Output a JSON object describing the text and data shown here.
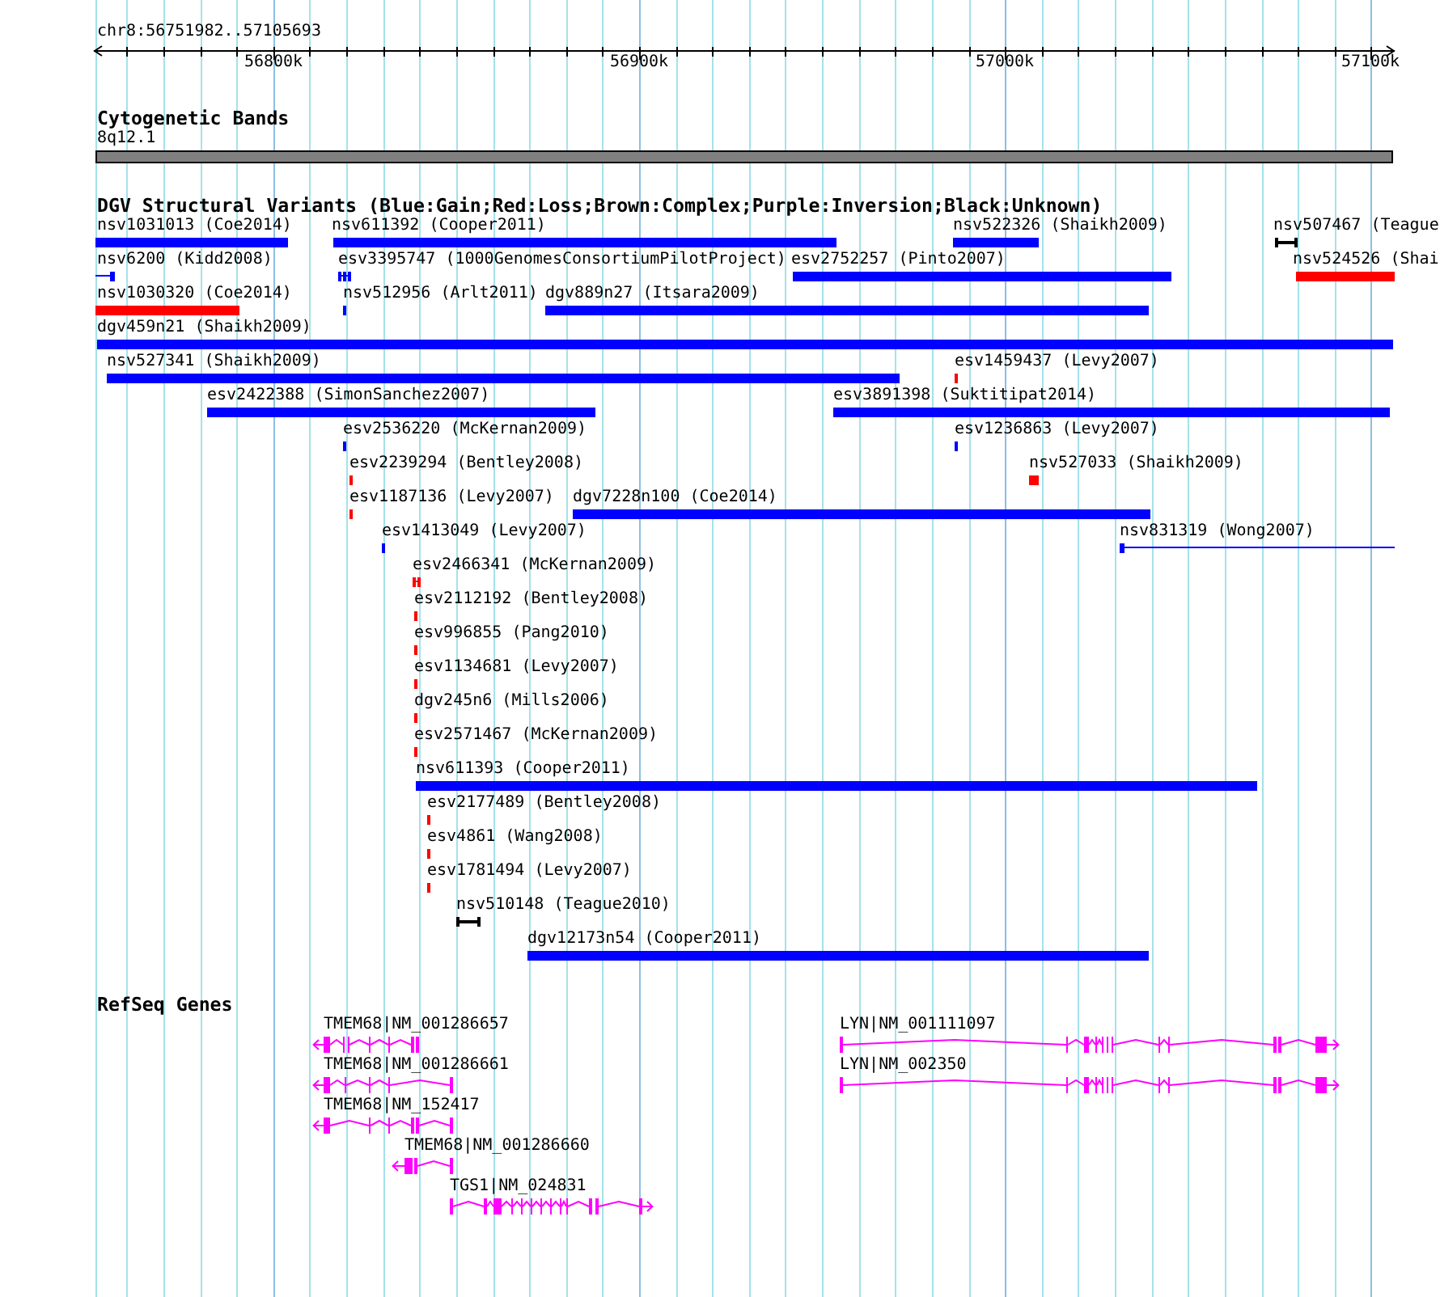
{
  "ruler": {
    "location": "chr8:56751982..57105693",
    "ticks": [
      "56800k",
      "56900k",
      "57000k",
      "57100k"
    ]
  },
  "cytogenetic_bands": {
    "title": "Cytogenetic Bands",
    "bands": [
      {
        "label": "8q12.1"
      }
    ]
  },
  "dgv_structural_variants": {
    "title": "DGV Structural Variants (Blue:Gain;Red:Loss;Brown:Complex;Purple:Inversion;Black:Unknown)",
    "rows": [
      {
        "variants": [
          {
            "label": "nsv1031013 (Coe2014)",
            "kind": "bar",
            "color": "#0000ff"
          },
          {
            "label": "nsv611392 (Cooper2011)",
            "kind": "bar",
            "color": "#0000ff"
          },
          {
            "label": "nsv522326 (Shaikh2009)",
            "kind": "bar",
            "color": "#0000ff"
          },
          {
            "label": "nsv507467 (Teague",
            "kind": "interval",
            "color": "#000000"
          }
        ]
      },
      {
        "variants": [
          {
            "label": "nsv6200 (Kidd2008)",
            "kind": "line",
            "color": "#0000ff"
          },
          {
            "label": "esv3395747 (1000GenomesConsortiumPilotProject)",
            "kind": "segments",
            "color": "#0000ff"
          },
          {
            "label": "esv2752257 (Pinto2007)",
            "kind": "bar",
            "color": "#0000ff"
          },
          {
            "label": "nsv524526 (Shai",
            "kind": "bar",
            "color": "#ff0000"
          }
        ]
      },
      {
        "variants": [
          {
            "label": "nsv1030320 (Coe2014)",
            "kind": "bar",
            "color": "#ff0000"
          },
          {
            "label": "nsv512956 (Arlt2011)",
            "kind": "bar",
            "color": "#0000ff"
          },
          {
            "label": "dgv889n27 (Itsara2009)",
            "kind": "bar",
            "color": "#0000ff"
          }
        ]
      },
      {
        "variants": [
          {
            "label": "dgv459n21 (Shaikh2009)",
            "kind": "bar",
            "color": "#0000ff"
          }
        ]
      },
      {
        "variants": [
          {
            "label": "nsv527341 (Shaikh2009)",
            "kind": "bar",
            "color": "#0000ff"
          },
          {
            "label": "esv1459437 (Levy2007)",
            "kind": "bar",
            "color": "#ff0000"
          }
        ]
      },
      {
        "variants": [
          {
            "label": "esv2422388 (SimonSanchez2007)",
            "kind": "bar",
            "color": "#0000ff"
          },
          {
            "label": "esv3891398 (Suktitipat2014)",
            "kind": "bar",
            "color": "#0000ff"
          }
        ]
      },
      {
        "variants": [
          {
            "label": "esv2536220 (McKernan2009)",
            "kind": "bar",
            "color": "#0000ff"
          },
          {
            "label": "esv1236863 (Levy2007)",
            "kind": "bar",
            "color": "#0000ff"
          }
        ]
      },
      {
        "variants": [
          {
            "label": "esv2239294 (Bentley2008)",
            "kind": "bar",
            "color": "#ff0000"
          },
          {
            "label": "nsv527033 (Shaikh2009)",
            "kind": "bar",
            "color": "#ff0000"
          }
        ]
      },
      {
        "variants": [
          {
            "label": "esv1187136 (Levy2007)",
            "kind": "bar",
            "color": "#ff0000"
          },
          {
            "label": "dgv7228n100 (Coe2014)",
            "kind": "bar",
            "color": "#0000ff"
          }
        ]
      },
      {
        "variants": [
          {
            "label": "esv1413049 (Levy2007)",
            "kind": "bar",
            "color": "#0000ff"
          },
          {
            "label": "nsv831319 (Wong2007)",
            "kind": "line",
            "color": "#0000ff"
          }
        ]
      },
      {
        "variants": [
          {
            "label": "esv2466341 (McKernan2009)",
            "kind": "segments",
            "color": "#ff0000"
          }
        ]
      },
      {
        "variants": [
          {
            "label": "esv2112192 (Bentley2008)",
            "kind": "bar",
            "color": "#ff0000"
          }
        ]
      },
      {
        "variants": [
          {
            "label": "esv996855 (Pang2010)",
            "kind": "bar",
            "color": "#ff0000"
          }
        ]
      },
      {
        "variants": [
          {
            "label": "esv1134681 (Levy2007)",
            "kind": "bar",
            "color": "#ff0000"
          }
        ]
      },
      {
        "variants": [
          {
            "label": "dgv245n6 (Mills2006)",
            "kind": "bar",
            "color": "#ff0000"
          }
        ]
      },
      {
        "variants": [
          {
            "label": "esv2571467 (McKernan2009)",
            "kind": "bar",
            "color": "#ff0000"
          }
        ]
      },
      {
        "variants": [
          {
            "label": "nsv611393 (Cooper2011)",
            "kind": "bar",
            "color": "#0000ff"
          }
        ]
      },
      {
        "variants": [
          {
            "label": "esv2177489 (Bentley2008)",
            "kind": "bar",
            "color": "#ff0000"
          }
        ]
      },
      {
        "variants": [
          {
            "label": "esv4861 (Wang2008)",
            "kind": "bar",
            "color": "#ff0000"
          }
        ]
      },
      {
        "variants": [
          {
            "label": "esv1781494 (Levy2007)",
            "kind": "bar",
            "color": "#ff0000"
          }
        ]
      },
      {
        "variants": [
          {
            "label": "nsv510148 (Teague2010)",
            "kind": "interval",
            "color": "#000000"
          }
        ]
      },
      {
        "variants": [
          {
            "label": "dgv12173n54 (Cooper2011)",
            "kind": "bar",
            "color": "#0000ff"
          }
        ]
      }
    ]
  },
  "refseq_genes": {
    "title": "RefSeq Genes",
    "rows": [
      {
        "genes": [
          {
            "label": "TMEM68|NM_001286657",
            "reverse_strand": true
          },
          {
            "label": "LYN|NM_001111097",
            "reverse_strand": false
          }
        ]
      },
      {
        "genes": [
          {
            "label": "TMEM68|NM_001286661",
            "reverse_strand": true
          },
          {
            "label": "LYN|NM_002350",
            "reverse_strand": false
          }
        ]
      },
      {
        "genes": [
          {
            "label": "TMEM68|NM_152417",
            "reverse_strand": true
          }
        ]
      },
      {
        "genes": [
          {
            "label": "TMEM68|NM_001286660",
            "reverse_strand": true
          }
        ]
      },
      {
        "genes": [
          {
            "label": "TGS1|NM_024831",
            "reverse_strand": false
          }
        ]
      }
    ]
  }
}
